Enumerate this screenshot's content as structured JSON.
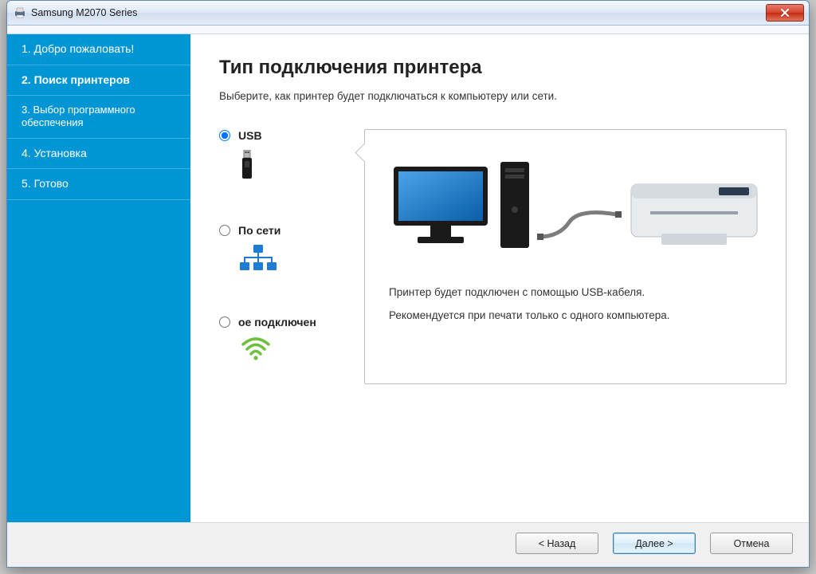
{
  "window": {
    "title": "Samsung M2070 Series"
  },
  "sidebar": {
    "steps": [
      {
        "label": "1. Добро пожаловать!"
      },
      {
        "label": "2. Поиск принтеров"
      },
      {
        "label": "3. Выбор программного обеспечения"
      },
      {
        "label": "4. Установка"
      },
      {
        "label": "5. Готово"
      }
    ],
    "active_index": 1
  },
  "main": {
    "heading": "Тип подключения принтера",
    "subtitle": "Выберите, как принтер будет подключаться к компьютеру или сети.",
    "options": {
      "usb": "USB",
      "network": "По сети",
      "wireless": "ое подключен"
    },
    "desc": {
      "line1": "Принтер будет подключен с помощью USB-кабеля.",
      "line2": "Рекомендуется при печати только с одного компьютера."
    }
  },
  "footer": {
    "back": "< Назад",
    "next": "Далее >",
    "cancel": "Отмена"
  }
}
